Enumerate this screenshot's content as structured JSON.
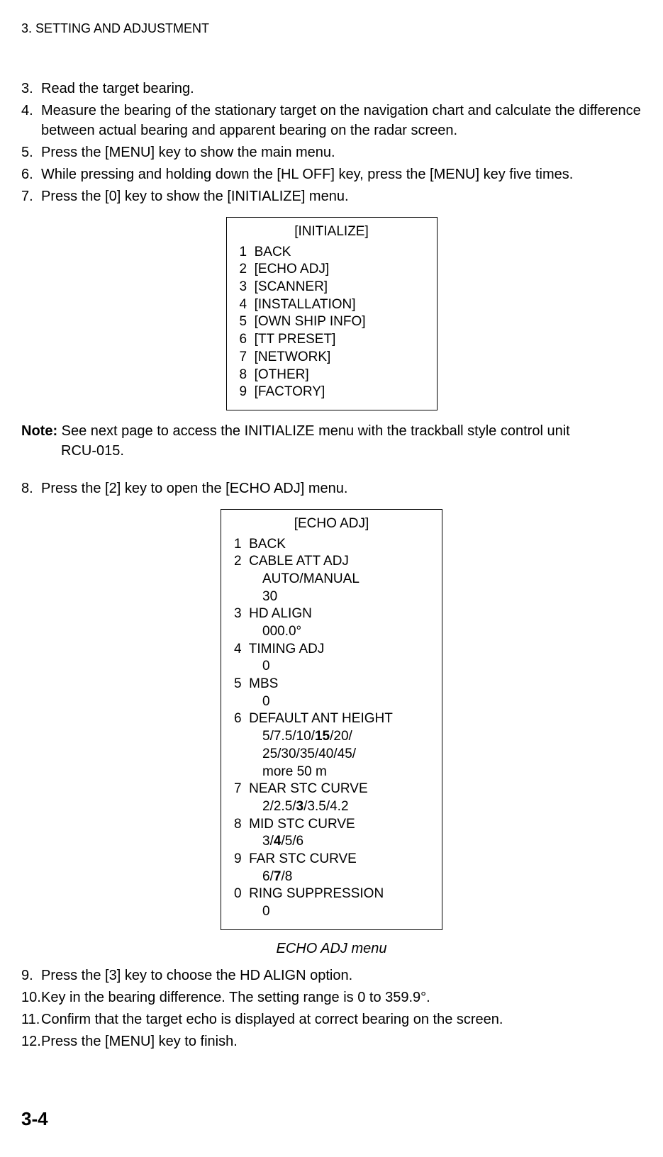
{
  "header": "3. SETTING AND ADJUSTMENT",
  "steps_a": [
    {
      "n": "3.",
      "t": "Read the target bearing."
    },
    {
      "n": "4.",
      "t": "Measure the bearing of the stationary target on the navigation chart and calculate the difference between actual bearing and apparent bearing on the radar screen."
    },
    {
      "n": "5.",
      "t": " Press the [MENU] key to show the main menu."
    },
    {
      "n": "6.",
      "t": " While pressing and holding down the [HL OFF] key, press the [MENU] key five times."
    },
    {
      "n": "7.",
      "t": "Press the [0] key to show the [INITIALIZE] menu."
    }
  ],
  "menu1": {
    "title": "[INITIALIZE]",
    "items": [
      "1  BACK",
      "2  [ECHO ADJ]",
      "3  [SCANNER]",
      "4  [INSTALLATION]",
      "5  [OWN SHIP INFO]",
      "6  [TT PRESET]",
      "7  [NETWORK]",
      "8  [OTHER]",
      "9  [FACTORY]"
    ]
  },
  "note": {
    "label": "Note:",
    "line1": " See next page to access the INITIALIZE menu with the trackball style control unit",
    "line2": "RCU-015."
  },
  "step8": {
    "n": "8.",
    "t": "Press the [2] key to open the [ECHO ADJ] menu."
  },
  "menu2": {
    "title": "[ECHO ADJ]",
    "rows": [
      {
        "text": "1  BACK"
      },
      {
        "text": "2  CABLE ATT ADJ"
      },
      {
        "indent": true,
        "text": "AUTO/MANUAL"
      },
      {
        "indent": true,
        "text": "30"
      },
      {
        "text": "3  HD ALIGN"
      },
      {
        "indent": true,
        "text": "000.0°"
      },
      {
        "text": "4  TIMING ADJ"
      },
      {
        "indent": true,
        "text": "0"
      },
      {
        "text": "5  MBS"
      },
      {
        "indent": true,
        "text": "0"
      },
      {
        "text": "6  DEFAULT ANT HEIGHT"
      },
      {
        "indent": true,
        "parts": [
          {
            "t": "5/7.5/10/"
          },
          {
            "t": "15",
            "b": true
          },
          {
            "t": "/20/"
          }
        ]
      },
      {
        "indent": true,
        "text": "25/30/35/40/45/"
      },
      {
        "indent": true,
        "text": "more 50 m"
      },
      {
        "text": "7  NEAR STC CURVE"
      },
      {
        "indent": true,
        "parts": [
          {
            "t": "2/2.5/"
          },
          {
            "t": "3",
            "b": true
          },
          {
            "t": "/3.5/4.2"
          }
        ]
      },
      {
        "text": "8  MID STC CURVE"
      },
      {
        "indent": true,
        "parts": [
          {
            "t": "3/"
          },
          {
            "t": "4",
            "b": true
          },
          {
            "t": "/5/6"
          }
        ]
      },
      {
        "text": "9  FAR STC CURVE"
      },
      {
        "indent": true,
        "parts": [
          {
            "t": "6/"
          },
          {
            "t": "7",
            "b": true
          },
          {
            "t": "/8"
          }
        ]
      },
      {
        "text": "0  RING SUPPRESSION"
      },
      {
        "indent": true,
        "text": "0"
      }
    ]
  },
  "caption": "ECHO ADJ menu",
  "steps_b": [
    {
      "n": "9.",
      "t": "Press the [3] key to choose the HD ALIGN option."
    },
    {
      "n": "10.",
      "t": "Key in the bearing difference. The setting range is 0 to 359.9°."
    },
    {
      "n": "11.",
      "t": "Confirm that the target echo is displayed at correct bearing on the screen."
    },
    {
      "n": "12.",
      "t": "Press the [MENU] key to finish."
    }
  ],
  "pageNum": "3-4"
}
